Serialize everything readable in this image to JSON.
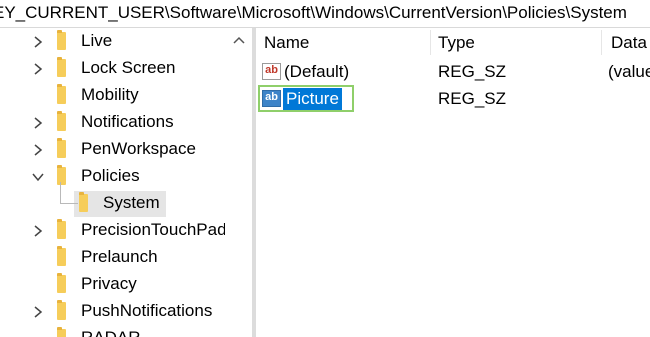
{
  "address_bar": {
    "path": "EY_CURRENT_USER\\Software\\Microsoft\\Windows\\CurrentVersion\\Policies\\System"
  },
  "tree": {
    "items": [
      {
        "label": "Live",
        "expandable": true,
        "expanded": false,
        "indent": 0,
        "selected": false
      },
      {
        "label": "Lock Screen",
        "expandable": true,
        "expanded": false,
        "indent": 0,
        "selected": false
      },
      {
        "label": "Mobility",
        "expandable": false,
        "expanded": false,
        "indent": 0,
        "selected": false
      },
      {
        "label": "Notifications",
        "expandable": true,
        "expanded": false,
        "indent": 0,
        "selected": false
      },
      {
        "label": "PenWorkspace",
        "expandable": true,
        "expanded": false,
        "indent": 0,
        "selected": false
      },
      {
        "label": "Policies",
        "expandable": true,
        "expanded": true,
        "indent": 0,
        "selected": false
      },
      {
        "label": "System",
        "expandable": false,
        "expanded": false,
        "indent": 1,
        "selected": true
      },
      {
        "label": "PrecisionTouchPad",
        "expandable": true,
        "expanded": false,
        "indent": 0,
        "selected": false
      },
      {
        "label": "Prelaunch",
        "expandable": false,
        "expanded": false,
        "indent": 0,
        "selected": false
      },
      {
        "label": "Privacy",
        "expandable": false,
        "expanded": false,
        "indent": 0,
        "selected": false
      },
      {
        "label": "PushNotifications",
        "expandable": true,
        "expanded": false,
        "indent": 0,
        "selected": false
      },
      {
        "label": "RADAR",
        "expandable": false,
        "expanded": false,
        "indent": 0,
        "selected": false
      }
    ]
  },
  "list": {
    "columns": [
      "Name",
      "Type",
      "Data"
    ],
    "rows": [
      {
        "name": "(Default)",
        "type": "REG_SZ",
        "data": "(value",
        "icon": "string-value-icon",
        "editing": false
      },
      {
        "name": "Picture",
        "type": "REG_SZ",
        "data": "",
        "icon": "string-value-icon",
        "editing": true
      }
    ]
  },
  "icons": {
    "value_icon_text": "ab"
  },
  "colors": {
    "folder": "#f6cd5a",
    "selection": "#e5e5e5",
    "edit_highlight": "#0078d7",
    "edit_border": "#8fcf6a"
  }
}
